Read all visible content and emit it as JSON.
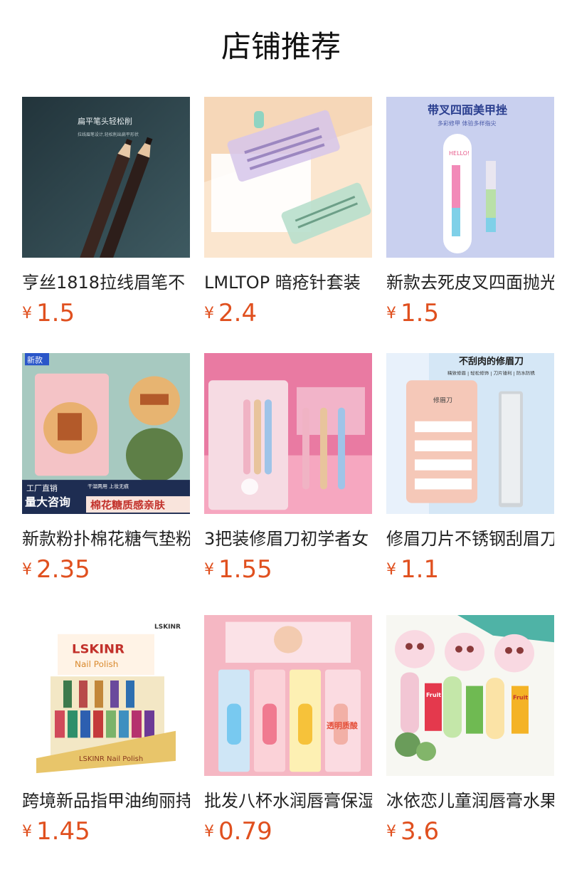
{
  "header": {
    "title": "店铺推荐"
  },
  "products": [
    {
      "name": "亨丝1818拉线眉笔不",
      "currency": "¥",
      "price": "1.5",
      "image_text": {
        "a": "扁平笔头轻松削",
        "b": "拉线眉笔设计,轻松削出扁平形状"
      }
    },
    {
      "name": "LMLTOP 暗疮针套装",
      "currency": "¥",
      "price": "2.4",
      "image_text": {}
    },
    {
      "name": "新款去死皮叉四面抛光",
      "currency": "¥",
      "price": "1.5",
      "image_text": {
        "a": "带叉四面美甲挫",
        "b": "多彩修甲 体验多样指尖",
        "c": "HELLO!"
      }
    },
    {
      "name": "新款粉扑棉花糖气垫粉扑",
      "currency": "¥",
      "price": "2.35",
      "image_text": {
        "a": "新款",
        "b": "工厂直销",
        "c": "量大咨询",
        "d": "棉花糖质感亲肤",
        "e": "干湿两用 上妆无痕"
      }
    },
    {
      "name": "3把装修眉刀初学者女",
      "currency": "¥",
      "price": "1.55",
      "image_text": {}
    },
    {
      "name": "修眉刀片不锈钢刮眉刀",
      "currency": "¥",
      "price": "1.1",
      "image_text": {
        "a": "不刮肉的修眉刀",
        "b": "精致修眉 | 轻松修饰 | 刀片锋利 | 防水防锈",
        "c": "修眉刀"
      }
    },
    {
      "name": "跨境新品指甲油绚丽持久",
      "currency": "¥",
      "price": "1.45",
      "image_text": {
        "a": "LSKINR",
        "b": "Nail Polish",
        "c": "LSKINR",
        "d": "LSKINR Nail Polish"
      }
    },
    {
      "name": "批发八杯水润唇膏保湿",
      "currency": "¥",
      "price": "0.79",
      "image_text": {
        "a": "透明质酸"
      }
    },
    {
      "name": "冰依恋儿童润唇膏水果味",
      "currency": "¥",
      "price": "3.6",
      "image_text": {
        "a": "Fruit",
        "b": "Fruit"
      }
    }
  ]
}
